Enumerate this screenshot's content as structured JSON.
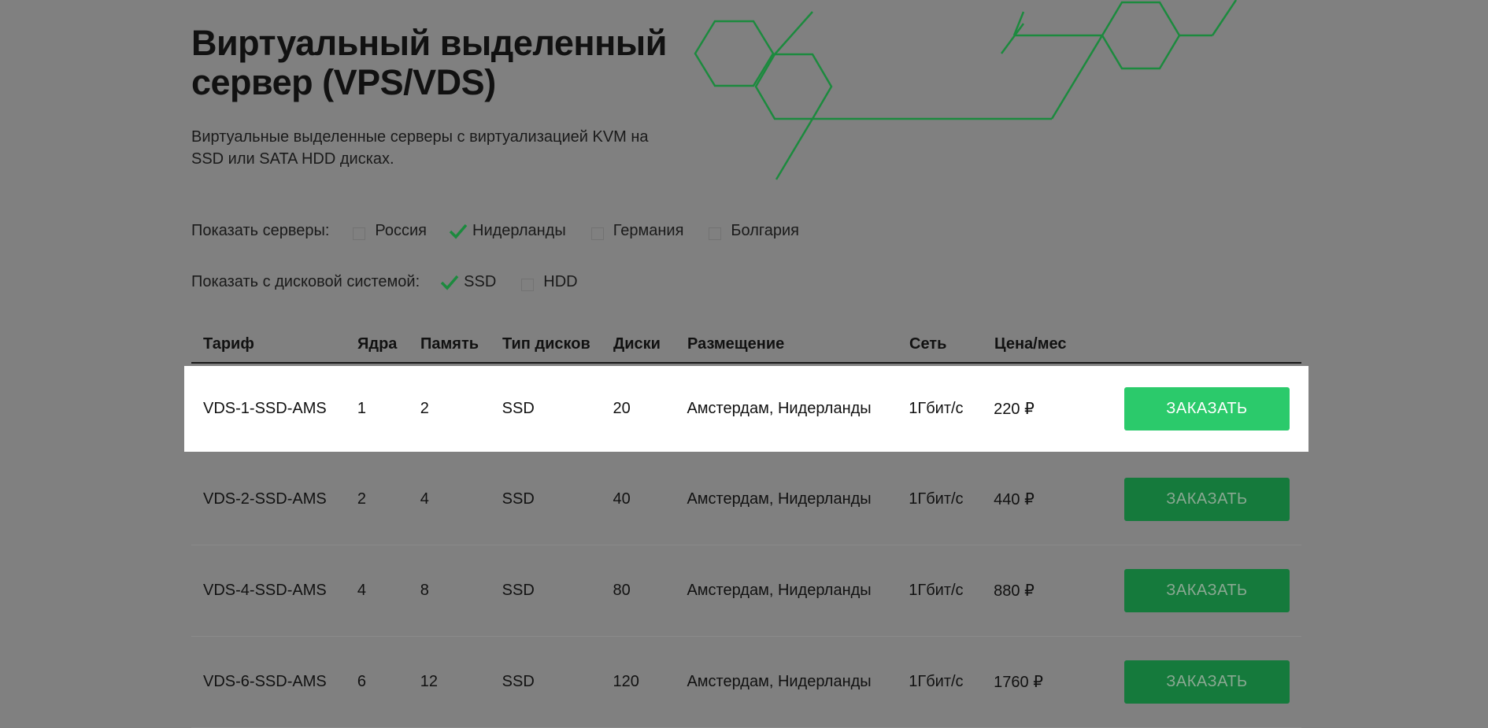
{
  "page": {
    "title": "Виртуальный выделенный сервер (VPS/VDS)",
    "subtitle": "Виртуальные выделенные серверы с виртуализацией KVM на SSD или SATA HDD дисках."
  },
  "filters": {
    "servers": {
      "label": "Показать серверы:",
      "options": [
        {
          "label": "Россия",
          "checked": false
        },
        {
          "label": "Нидерланды",
          "checked": true
        },
        {
          "label": "Германия",
          "checked": false
        },
        {
          "label": "Болгария",
          "checked": false
        }
      ]
    },
    "disks": {
      "label": "Показать с дисковой системой:",
      "options": [
        {
          "label": "SSD",
          "checked": true
        },
        {
          "label": "HDD",
          "checked": false
        }
      ]
    }
  },
  "table": {
    "headers": [
      "Тариф",
      "Ядра",
      "Память",
      "Тип дисков",
      "Диски",
      "Размещение",
      "Сеть",
      "Цена/мес"
    ],
    "rows": [
      {
        "plan": "VDS-1-SSD-AMS",
        "cores": "1",
        "memory": "2",
        "disk_type": "SSD",
        "disks": "20",
        "location": "Амстердам, Нидерланды",
        "network": "1Гбит/с",
        "price": "220 ₽",
        "button": "ЗАКАЗАТЬ"
      },
      {
        "plan": "VDS-2-SSD-AMS",
        "cores": "2",
        "memory": "4",
        "disk_type": "SSD",
        "disks": "40",
        "location": "Амстердам, Нидерланды",
        "network": "1Гбит/с",
        "price": "440 ₽",
        "button": "ЗАКАЗАТЬ"
      },
      {
        "plan": "VDS-4-SSD-AMS",
        "cores": "4",
        "memory": "8",
        "disk_type": "SSD",
        "disks": "80",
        "location": "Амстердам, Нидерланды",
        "network": "1Гбит/с",
        "price": "880 ₽",
        "button": "ЗАКАЗАТЬ"
      },
      {
        "plan": "VDS-6-SSD-AMS",
        "cores": "6",
        "memory": "12",
        "disk_type": "SSD",
        "disks": "120",
        "location": "Амстердам, Нидерланды",
        "network": "1Гбит/с",
        "price": "1760 ₽",
        "button": "ЗАКАЗАТЬ"
      }
    ],
    "highlighted_row": 0
  },
  "colors": {
    "overlay": "#808080",
    "accent": "#2bca6b",
    "accent_dimmed": "#157a3c",
    "decoration": "#1c8a3e"
  },
  "icons": {
    "checkmark": "check-icon",
    "decoration": "hexagon-pattern"
  }
}
